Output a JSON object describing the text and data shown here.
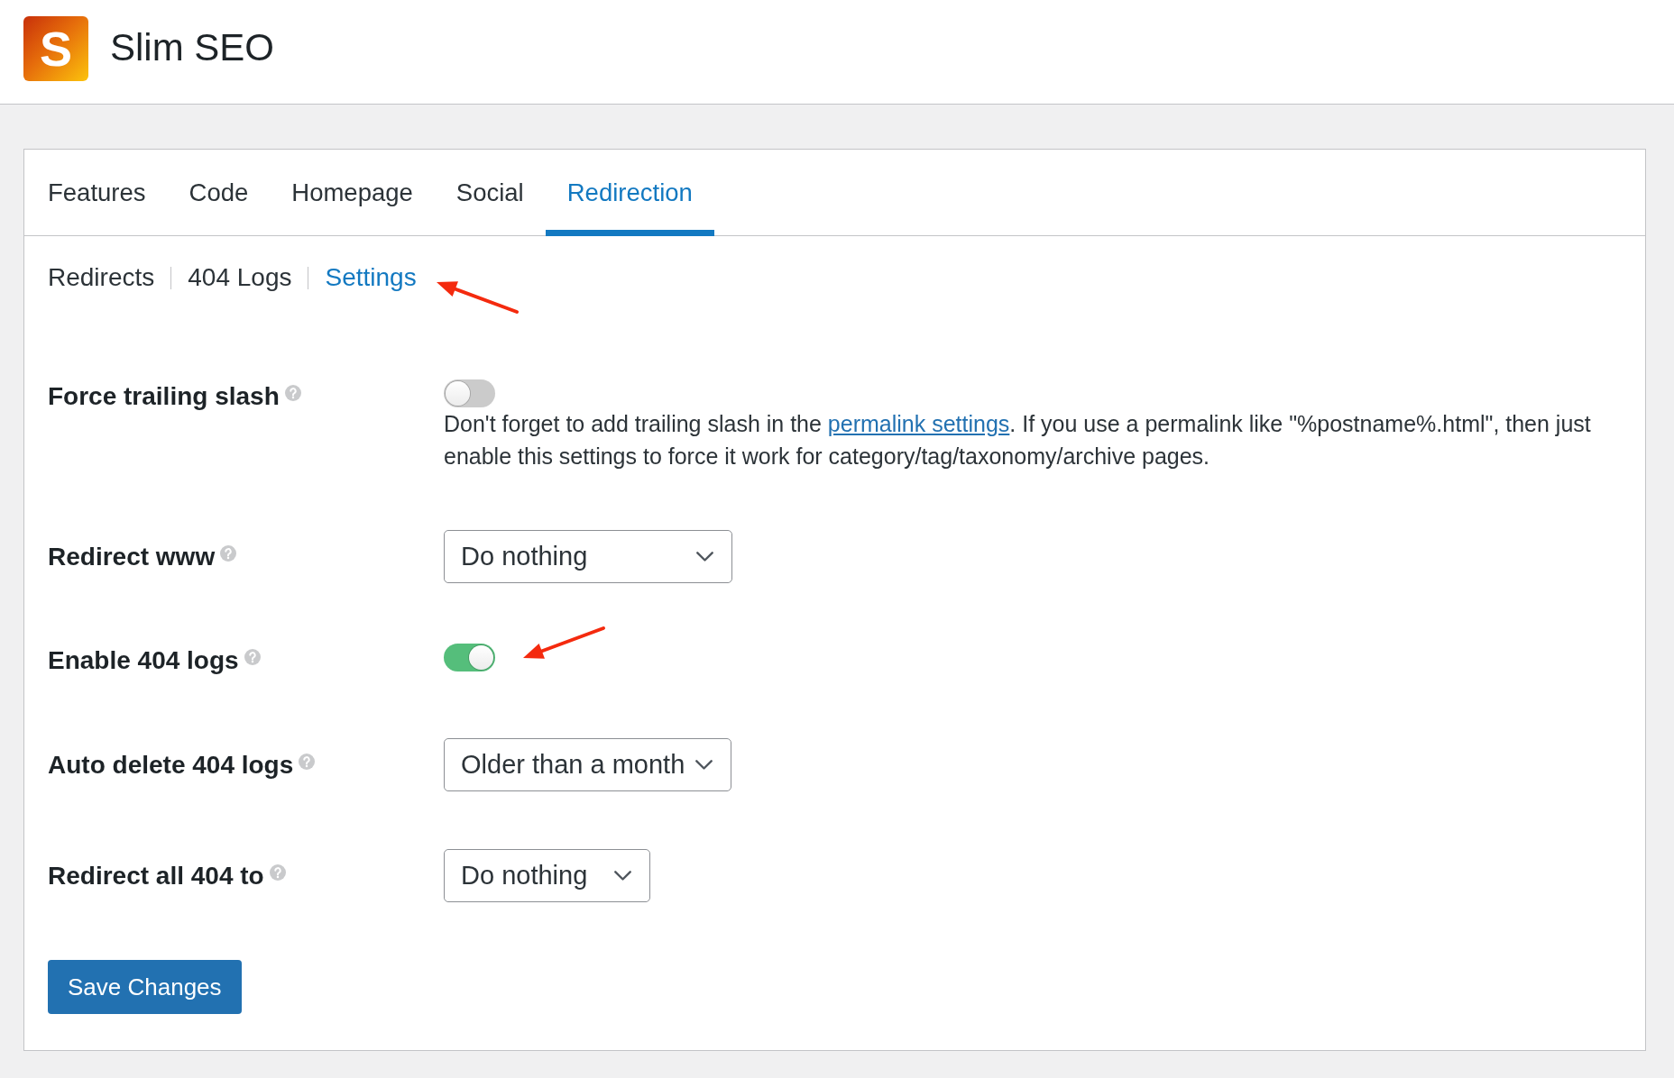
{
  "header": {
    "logo_letter": "S",
    "title": "Slim SEO"
  },
  "tabs": [
    {
      "label": "Features",
      "selected": false
    },
    {
      "label": "Code",
      "selected": false
    },
    {
      "label": "Homepage",
      "selected": false
    },
    {
      "label": "Social",
      "selected": false
    },
    {
      "label": "Redirection",
      "selected": true
    }
  ],
  "subnav": [
    {
      "label": "Redirects",
      "selected": false,
      "arrow": false
    },
    {
      "label": "404 Logs",
      "selected": false,
      "arrow": false
    },
    {
      "label": "Settings",
      "selected": true,
      "arrow": true
    }
  ],
  "settings": [
    {
      "kind": "toggle",
      "label": "Force trailing slash",
      "on": false,
      "arrow": false,
      "description": [
        {
          "kind": "text",
          "text": "Don't forget to add trailing slash in the "
        },
        {
          "kind": "link",
          "text": "permalink settings"
        },
        {
          "kind": "text",
          "text": ". If you use a permalink like \"%postname%.html\", then just enable this settings to force it work for category/tag/taxonomy/archive pages."
        }
      ]
    },
    {
      "kind": "select",
      "label": "Redirect www",
      "value": "Do nothing"
    },
    {
      "kind": "toggle",
      "label": "Enable 404 logs",
      "on": true,
      "arrow": true
    },
    {
      "kind": "select",
      "label": "Auto delete 404 logs",
      "value": "Older than a month"
    },
    {
      "kind": "select",
      "label": "Redirect all 404 to",
      "value": "Do nothing"
    }
  ],
  "save_button": {
    "label": "Save Changes"
  }
}
